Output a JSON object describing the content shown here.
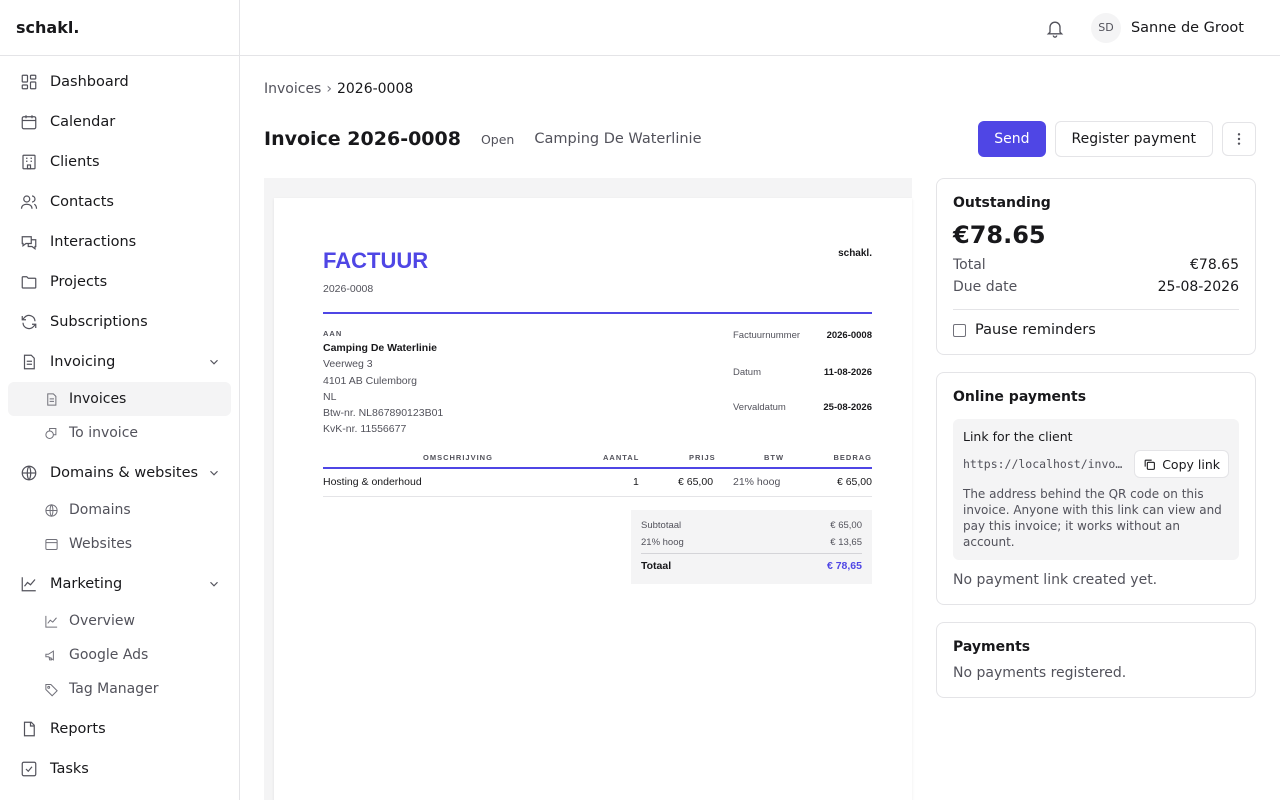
{
  "brand": "schakl.",
  "sidebar": {
    "items": [
      {
        "label": "Dashboard",
        "icon": "dashboard-icon"
      },
      {
        "label": "Calendar",
        "icon": "calendar-icon"
      },
      {
        "label": "Clients",
        "icon": "clients-icon"
      },
      {
        "label": "Contacts",
        "icon": "contacts-icon"
      },
      {
        "label": "Interactions",
        "icon": "interactions-icon"
      },
      {
        "label": "Projects",
        "icon": "folder-icon"
      },
      {
        "label": "Subscriptions",
        "icon": "refresh-icon"
      }
    ],
    "invoicing": {
      "label": "Invoicing",
      "sub": [
        "Invoices",
        "To invoice"
      ]
    },
    "domains": {
      "label": "Domains & websites",
      "sub": [
        "Domains",
        "Websites"
      ]
    },
    "marketing": {
      "label": "Marketing",
      "sub": [
        "Overview",
        "Google Ads",
        "Tag Manager"
      ]
    },
    "bottom": [
      "Reports",
      "Tasks"
    ]
  },
  "user": {
    "initials": "SD",
    "name": "Sanne de Groot"
  },
  "breadcrumb": {
    "parent": "Invoices",
    "separator": "›",
    "current": "2026-0008"
  },
  "header": {
    "title": "Invoice 2026-0008",
    "status": "Open",
    "client": "Camping De Waterlinie",
    "send_label": "Send",
    "register_label": "Register payment"
  },
  "invoice": {
    "title": "FACTUUR",
    "number": "2026-0008",
    "brand": "schakl.",
    "to_label": "AAN",
    "recipient": {
      "name": "Camping De Waterlinie",
      "lines": [
        "Veerweg 3",
        "4101 AB Culemborg",
        "NL",
        "Btw-nr. NL867890123B01",
        "KvK-nr. 11556677"
      ]
    },
    "meta": [
      {
        "label": "Factuurnummer",
        "value": "2026-0008"
      },
      {
        "label": "Datum",
        "value": "11-08-2026"
      },
      {
        "label": "Vervaldatum",
        "value": "25-08-2026"
      }
    ],
    "columns": [
      "OMSCHRIJVING",
      "AANTAL",
      "PRIJS",
      "BTW",
      "BEDRAG"
    ],
    "rows": [
      {
        "description": "Hosting & onderhoud",
        "qty": "1",
        "price": "€ 65,00",
        "vat": "21% hoog",
        "amount": "€ 65,00"
      }
    ],
    "totals": {
      "subtotal_label": "Subtotaal",
      "subtotal": "€ 65,00",
      "vat_label": "21% hoog",
      "vat": "€ 13,65",
      "total_label": "Totaal",
      "total": "€ 78,65"
    }
  },
  "outstanding": {
    "title": "Outstanding",
    "amount": "€78.65",
    "total_label": "Total",
    "total": "€78.65",
    "due_label": "Due date",
    "due": "25-08-2026",
    "pause_label": "Pause reminders"
  },
  "online_payments": {
    "title": "Online payments",
    "link_title": "Link for the client",
    "url": "https://localhost/invo…",
    "copy_label": "Copy link",
    "help": "The address behind the QR code on this invoice. Anyone with this link can view and pay this invoice; it works without an account.",
    "empty": "No payment link created yet."
  },
  "payments": {
    "title": "Payments",
    "empty": "No payments registered."
  },
  "colors": {
    "accent": "#4f46e5",
    "border": "#e4e4e7",
    "muted": "#52525b"
  }
}
